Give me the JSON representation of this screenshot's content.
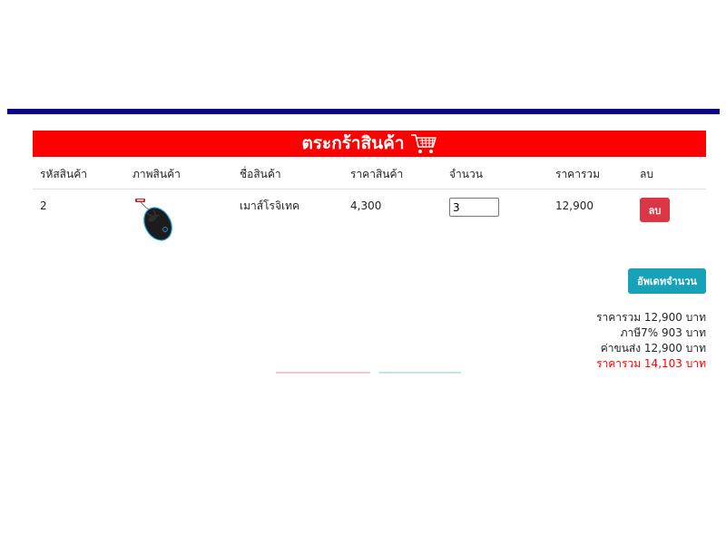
{
  "cart": {
    "title": "ตระกร้าสินค้า",
    "title_icon": "shopping-cart-icon",
    "colors": {
      "title_bg": "#ff0000",
      "top_rule": "#0b0087",
      "delete_btn": "#dc3545",
      "update_btn": "#17a2b8",
      "grand_total_text": "#ff0000"
    }
  },
  "table": {
    "headers": {
      "code": "รหัสสินค้า",
      "image": "ภาพสินค้า",
      "name": "ชื่อสินค้า",
      "price": "ราคาสินค้า",
      "qty": "จำนวน",
      "total": "ราคารวม",
      "delete": "ลบ"
    },
    "rows": [
      {
        "code": "2",
        "image_icon": "computer-mouse-icon",
        "name": "เมาส์โรจิเทค",
        "price": "4,300",
        "qty": "3",
        "total": "12,900",
        "delete_label": "ลบ"
      }
    ]
  },
  "actions": {
    "update_label": "อัพเดทจำนวน"
  },
  "summary": {
    "subtotal": "ราคารวม 12,900 บาท",
    "vat": "ภาษี7% 903 บาท",
    "shipping": "ค่าขนส่ง 12,900 บาท",
    "grand_total": "ราคารวม 14,103 บาท"
  }
}
